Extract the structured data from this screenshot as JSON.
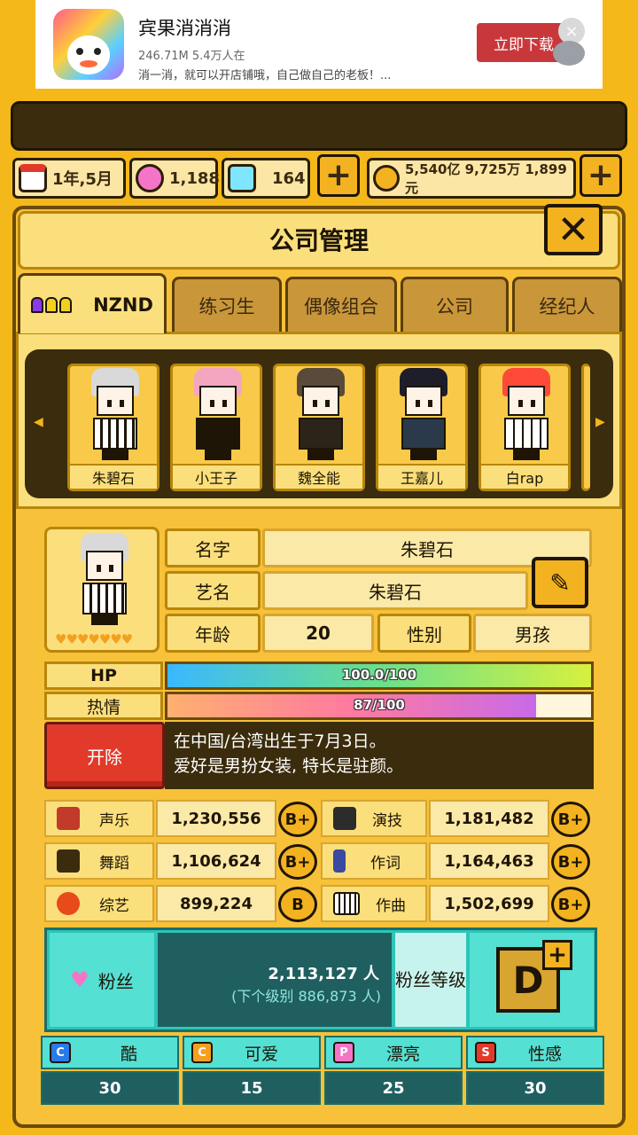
{
  "ad": {
    "title": "宾果消消消",
    "meta": "246.71M 5.4万人在",
    "desc": "消一消，就可以开店铺哦，自己做自己的老板！...",
    "button": "立即下载",
    "close": "×"
  },
  "resources": {
    "date": "1年,5月",
    "pink_gems": "1,188",
    "blue_gems": "164",
    "money": "5,540亿 9,725万 1,899元",
    "plus": "+"
  },
  "panel": {
    "title": "公司管理",
    "close": "✕"
  },
  "tabs": [
    {
      "label": "NZND",
      "active": true
    },
    {
      "label": "练习生",
      "active": false
    },
    {
      "label": "偶像组合",
      "active": false
    },
    {
      "label": "公司",
      "active": false
    },
    {
      "label": "经纪人",
      "active": false
    }
  ],
  "members": [
    {
      "name": "朱碧石",
      "hair": "#d9d9d9"
    },
    {
      "name": "小王子",
      "hair": "#f4a6c0"
    },
    {
      "name": "魏全能",
      "hair": "#5a4a3a"
    },
    {
      "name": "王嘉儿",
      "hair": "#1e1e2a"
    },
    {
      "name": "白rap",
      "hair": "#ff4a3a"
    }
  ],
  "carousel": {
    "left_arrow": "◀",
    "right_arrow": "▶"
  },
  "profile": {
    "name_label": "名字",
    "name_value": "朱碧石",
    "stage_label": "艺名",
    "stage_value": "朱碧石",
    "age_label": "年龄",
    "age_value": "20",
    "gender_label": "性别",
    "gender_value": "男孩",
    "edit": "✎",
    "hearts": "♥♥♥♥♥♥♥"
  },
  "bars": {
    "hp_label": "HP",
    "hp_text": "100.0/100",
    "hp_fraction": 1.0,
    "passion_label": "热情",
    "passion_text": "87/100",
    "passion_fraction": 0.87
  },
  "fire_button": "开除",
  "bio": {
    "line1": "在中国/台湾出生于7月3日。",
    "line2": "爱好是男扮女装, 特长是驻颜。"
  },
  "stats": [
    {
      "label": "声乐",
      "value": "1,230,556",
      "grade": "B+",
      "icon_color": "#c23a2a"
    },
    {
      "label": "演技",
      "value": "1,181,482",
      "grade": "B+",
      "icon_color": "#2c2c2c"
    },
    {
      "label": "舞蹈",
      "value": "1,106,624",
      "grade": "B+",
      "icon_color": "#3a2c0c"
    },
    {
      "label": "作词",
      "value": "1,164,463",
      "grade": "B+",
      "icon_color": "#3a4aa0"
    },
    {
      "label": "综艺",
      "value": "899,224",
      "grade": "B",
      "icon_color": "#e84a1a"
    },
    {
      "label": "作曲",
      "value": "1,502,699",
      "grade": "B+",
      "icon_color": "#1e1506"
    }
  ],
  "fans": {
    "label": "粉丝",
    "count": "2,113,127 人",
    "next": "(下个级别 886,873 人)",
    "level_label": "粉丝等级",
    "level_grade": "D",
    "level_plus": "+"
  },
  "attributes": [
    {
      "label": "酷",
      "value": "30",
      "letter": "C",
      "color": "#2a7ae8"
    },
    {
      "label": "可爱",
      "value": "15",
      "letter": "C",
      "color": "#f3a020"
    },
    {
      "label": "漂亮",
      "value": "25",
      "letter": "P",
      "color": "#f474c8"
    },
    {
      "label": "性感",
      "value": "30",
      "letter": "S",
      "color": "#e23a2a"
    }
  ]
}
